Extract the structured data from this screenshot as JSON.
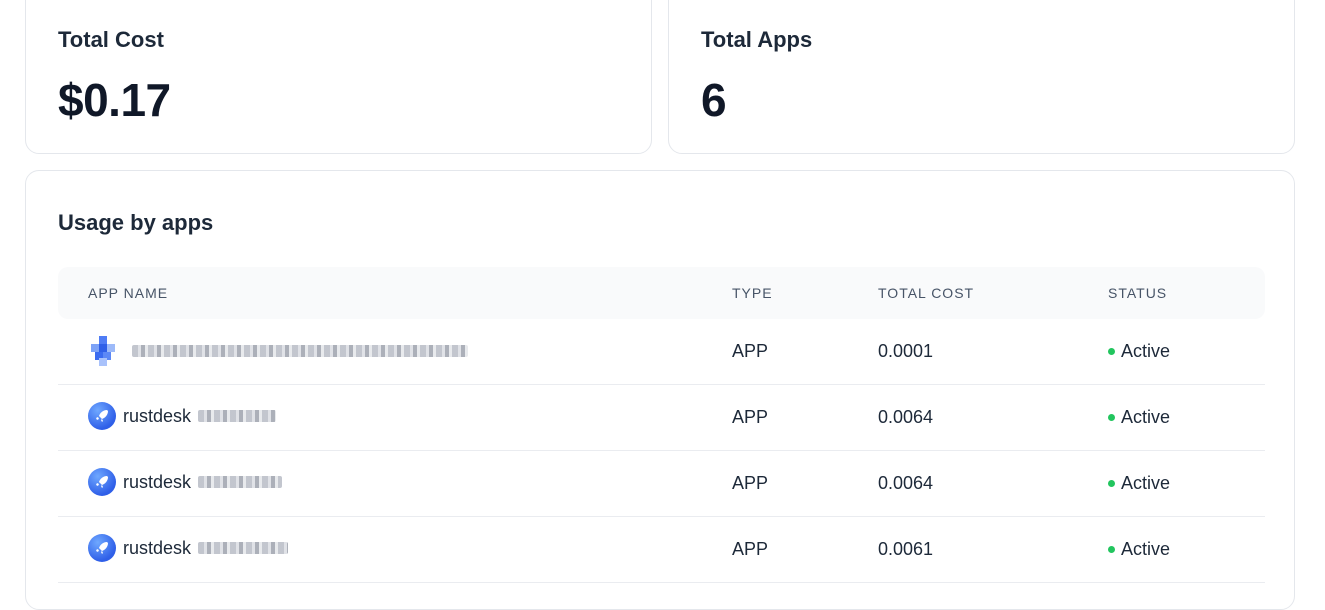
{
  "stats": {
    "total_cost": {
      "label": "Total Cost",
      "value": "$0.17"
    },
    "total_apps": {
      "label": "Total Apps",
      "value": "6"
    }
  },
  "usage": {
    "title": "Usage by apps",
    "columns": [
      "APP NAME",
      "TYPE",
      "TOTAL COST",
      "STATUS"
    ],
    "rows": [
      {
        "name": "",
        "type": "APP",
        "cost": "0.0001",
        "status": "Active"
      },
      {
        "name": "rustdesk",
        "type": "APP",
        "cost": "0.0064",
        "status": "Active"
      },
      {
        "name": "rustdesk",
        "type": "APP",
        "cost": "0.0064",
        "status": "Active"
      },
      {
        "name": "rustdesk",
        "type": "APP",
        "cost": "0.0061",
        "status": "Active"
      }
    ]
  },
  "colors": {
    "active": "#22c55e",
    "icon": "#2f5fe8"
  }
}
